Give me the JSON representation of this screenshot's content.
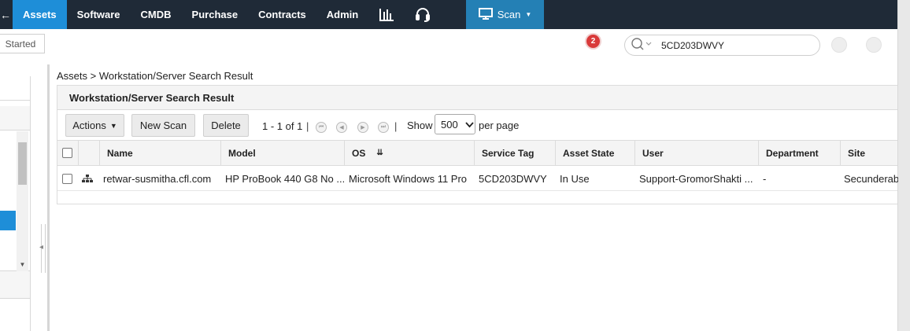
{
  "nav": {
    "edge_glyph": "←",
    "items": [
      {
        "label": "Assets",
        "active": true
      },
      {
        "label": "Software"
      },
      {
        "label": "CMDB"
      },
      {
        "label": "Purchase"
      },
      {
        "label": "Contracts"
      },
      {
        "label": "Admin"
      }
    ],
    "icons": [
      "reports-chart-icon",
      "headset-support-icon"
    ],
    "scan_label": "Scan",
    "colors": {
      "bar": "#1f2a37",
      "active": "#1e8ed8",
      "scan": "#2480b5"
    }
  },
  "subbar": {
    "started_label": "Started",
    "notification_count": "2",
    "search_value": "5CD203DWVY"
  },
  "breadcrumb": "Assets > Workstation/Server Search Result",
  "panel": {
    "title": "Workstation/Server Search Result",
    "toolbar": {
      "actions_label": "Actions",
      "new_scan_label": "New Scan",
      "delete_label": "Delete",
      "range_text": "1 - 1 of 1",
      "show_label": "Show",
      "page_size": "500",
      "per_page_label": "per page"
    },
    "columns": [
      "Name",
      "Model",
      "OS",
      "Service Tag",
      "Asset State",
      "User",
      "Department",
      "Site"
    ],
    "rows": [
      {
        "name": "retwar-susmitha.cfl.com",
        "model": "HP ProBook 440 G8 No ...",
        "os": "Microsoft Windows 11 Pro",
        "service_tag": "5CD203DWVY",
        "asset_state": "In Use",
        "user": "Support-GromorShakti ...",
        "department": "-",
        "site": "Secunderab"
      }
    ]
  }
}
